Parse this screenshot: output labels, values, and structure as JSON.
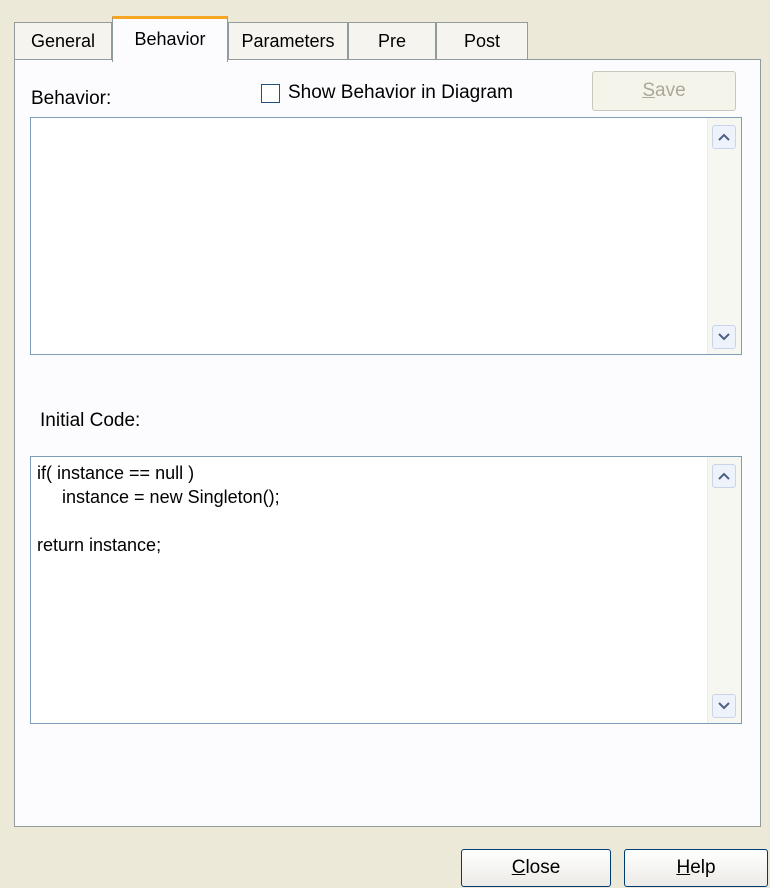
{
  "tabs": [
    "General",
    "Behavior",
    "Parameters",
    "Pre",
    "Post"
  ],
  "behavior": {
    "label": "Behavior:",
    "show_in_diagram_label": "Show Behavior in Diagram",
    "show_in_diagram_checked": false,
    "save_label": "Save",
    "save_accel": "S",
    "save_rest": "ave",
    "text": ""
  },
  "initial_code": {
    "label": "Initial Code:",
    "text": "if( instance == null )\n     instance = new Singleton();\n\nreturn instance;"
  },
  "buttons": {
    "close_accel": "C",
    "close_rest": "lose",
    "help_accel": "H",
    "help_rest": "elp"
  },
  "icons": {
    "scroll_up": "scroll-up-arrow-icon",
    "scroll_down": "scroll-down-arrow-icon"
  }
}
